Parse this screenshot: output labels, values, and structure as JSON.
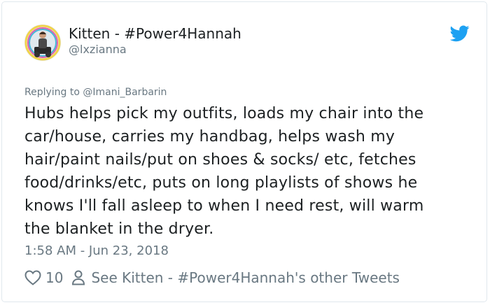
{
  "tweet": {
    "author_name": "Kitten - #Power4Hannah",
    "author_handle": "@lxzianna",
    "replying_prefix": "Replying to ",
    "replying_to": "@Imani_Barbarin",
    "text_lines": [
      "Hubs helps pick my outfits, loads my chair into the",
      "car/house, carries my handbag, helps wash my",
      "hair/paint nails/put on shoes & socks/ etc, fetches",
      "food/drinks/etc, puts on long playlists of shows he",
      "knows I'll fall asleep to when I need rest, will warm",
      "the blanket in the dryer."
    ],
    "timestamp": "1:58 AM - Jun 23, 2018",
    "like_count": "10",
    "other_tweets_link": "See Kitten - #Power4Hannah's other Tweets"
  },
  "icons": {
    "brand": "twitter-bird-icon",
    "like": "heart-icon",
    "profile": "person-icon"
  },
  "colors": {
    "twitter_blue": "#1da1f2",
    "text": "#1c2022",
    "secondary_text": "#697882",
    "border": "#e1e8ed"
  }
}
